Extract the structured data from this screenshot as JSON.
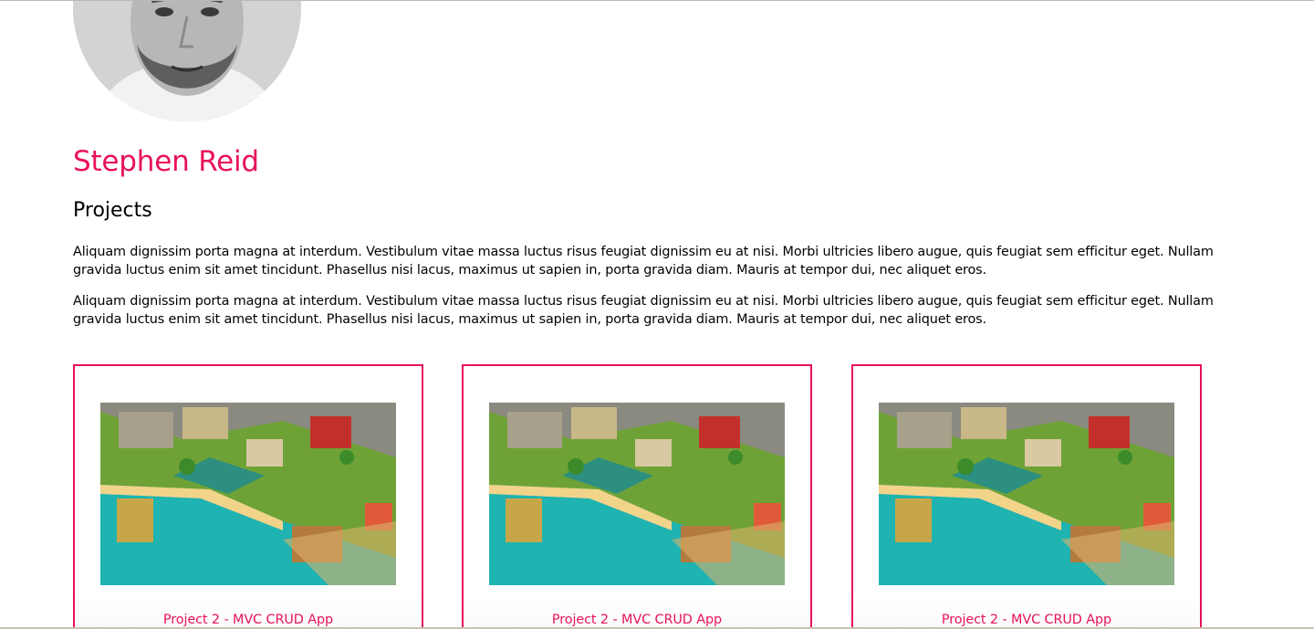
{
  "colors": {
    "accent": "#e8125c",
    "text": "#000000",
    "background": "#ffffff"
  },
  "profile": {
    "name": "Stephen Reid",
    "avatar_icon": "portrait-photo-icon"
  },
  "section": {
    "title": "Projects",
    "paragraphs": [
      "Aliquam dignissim porta magna at interdum. Vestibulum vitae massa luctus risus feugiat dignissim eu at nisi. Morbi ultricies libero augue, quis feugiat sem efficitur eget. Nullam gravida luctus enim sit amet tincidunt. Phasellus nisi lacus, maximus ut sapien in, porta gravida diam. Mauris at tempor dui, nec aliquet eros.",
      "Aliquam dignissim porta magna at interdum. Vestibulum vitae massa luctus risus feugiat dignissim eu at nisi. Morbi ultricies libero augue, quis feugiat sem efficitur eget. Nullam gravida luctus enim sit amet tincidunt. Phasellus nisi lacus, maximus ut sapien in, porta gravida diam. Mauris at tempor dui, nec aliquet eros."
    ]
  },
  "projects": [
    {
      "title": "Project 2 - MVC CRUD App",
      "image_icon": "isometric-town-image"
    },
    {
      "title": "Project 2 - MVC CRUD App",
      "image_icon": "isometric-town-image"
    },
    {
      "title": "Project 2 - MVC CRUD App",
      "image_icon": "isometric-town-image"
    }
  ]
}
